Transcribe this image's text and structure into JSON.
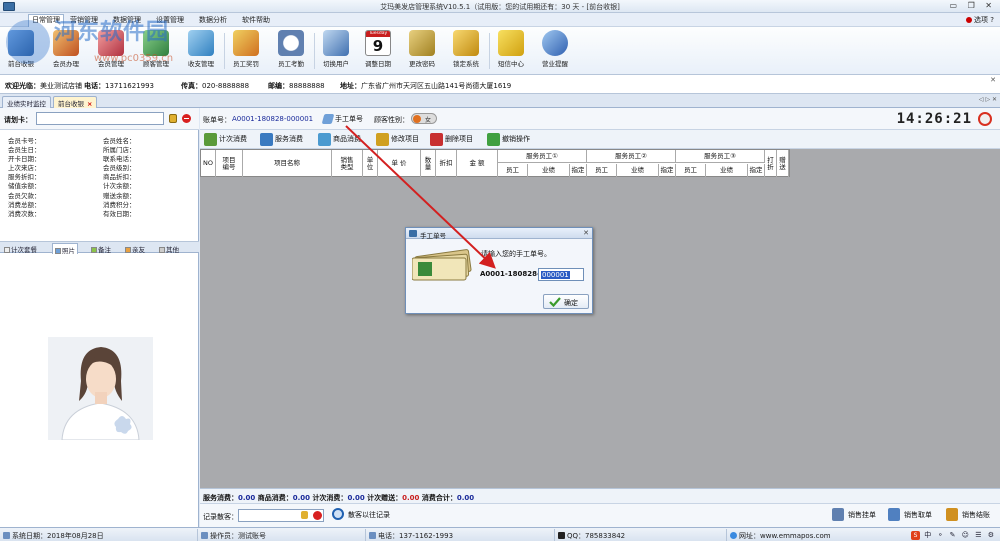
{
  "window": {
    "title": "艾玛美发店管理系统V10.5.1（试用版：您的试用期还有：30 天 - [前台收银]",
    "controls": "▭ ❐ ✕"
  },
  "menu": {
    "items": [
      "日常管理",
      "营销管理",
      "数据管理",
      "设置管理",
      "数据分析",
      "软件帮助"
    ],
    "options_label": "选项",
    "help_label": "?"
  },
  "ribbon": {
    "buttons": [
      {
        "label": "前台收银",
        "icon": "cash-register-icon"
      },
      {
        "label": "会员办理",
        "icon": "member-icon"
      },
      {
        "label": "会员管理",
        "icon": "member-manage-icon"
      },
      {
        "label": "顾客管理",
        "icon": "customer-icon"
      },
      {
        "label": "收支管理",
        "icon": "finance-icon"
      },
      {
        "label": "员工奖罚",
        "icon": "reward-icon"
      },
      {
        "label": "员工考勤",
        "icon": "attendance-clock-icon"
      },
      {
        "label": "切换用户",
        "icon": "switch-user-icon"
      },
      {
        "label": "调整日期",
        "icon": "calendar-icon"
      },
      {
        "label": "更改密码",
        "icon": "key-icon"
      },
      {
        "label": "锁定系统",
        "icon": "lock-icon"
      },
      {
        "label": "短信中心",
        "icon": "sms-icon"
      },
      {
        "label": "营业提醒",
        "icon": "reminder-icon"
      }
    ],
    "calendar": {
      "month": "Tuesday",
      "day": "9"
    }
  },
  "infobar": {
    "shop_label": "欢迎光临：",
    "shop_value": "美业测试店铺",
    "phone_label": "电话：",
    "phone_value": "13711621993",
    "fax_label": "传真：",
    "fax_value": "020-8888888",
    "post_label": "邮编：",
    "post_value": "88888888",
    "address_label": "地址：",
    "address_value": "广东省广州市天河区五山路141号尚德大厦1619"
  },
  "tabs": [
    {
      "label": "业绩实时监控"
    },
    {
      "label": "前台收银",
      "close": "×"
    }
  ],
  "tabs_nav": "◁ ▷ ✕",
  "left": {
    "card_label": "请划卡：",
    "card_value": "",
    "member_fields": [
      [
        "会员卡号：",
        "会员姓名："
      ],
      [
        "会员生日：",
        "所属门店："
      ],
      [
        "开卡日期：",
        "联系电话："
      ],
      [
        "上次来店：",
        "会员级别："
      ],
      [
        "服务折扣：",
        "商品折扣："
      ],
      [
        "储值余额：",
        "计次余额："
      ],
      [
        "会员欠款：",
        "赠送余额："
      ],
      [
        "消费总额：",
        "消费积分："
      ],
      [
        "消费次数：",
        "有效日期："
      ]
    ],
    "subtabs": [
      "计次套餐",
      "照片",
      "备注",
      "亲友",
      "其他"
    ],
    "active_subtab": "照片"
  },
  "main": {
    "bill_label": "账单号：",
    "bill_no": "A0001-180828-000001",
    "manual_label": "手工单号",
    "gender_label": "顾客性别：",
    "gender_value": "女",
    "clock": "14:26:21",
    "actions": [
      {
        "label": "计次消费",
        "icon": "count-consume-icon",
        "color": "#5a9a3a"
      },
      {
        "label": "服务消费",
        "icon": "service-consume-icon",
        "color": "#3a7ac0"
      },
      {
        "label": "商品消费",
        "icon": "product-consume-icon",
        "color": "#4a9ad0"
      },
      {
        "label": "修改项目",
        "icon": "edit-item-icon",
        "color": "#d0a020"
      },
      {
        "label": "删除项目",
        "icon": "delete-item-icon",
        "color": "#c83030"
      },
      {
        "label": "撤销操作",
        "icon": "undo-icon",
        "color": "#40a040"
      }
    ],
    "grid": {
      "no": "NO",
      "item_code": "项目\n编号",
      "item_name": "项目名称",
      "sale_type": "销售\n类型",
      "unit": "单\n位",
      "price": "单 价",
      "qty": "数\n量",
      "discount": "折扣",
      "amount": "金 额",
      "staff_groups": [
        "服务员工①",
        "服务员工②",
        "服务员工③"
      ],
      "staff_sub": [
        "员工",
        "业绩",
        "指定"
      ],
      "print": "打\n折",
      "gift": "赠\n送"
    },
    "totals": [
      {
        "label": "服务消费：",
        "value": "0.00",
        "red": false
      },
      {
        "label": "商品消费：",
        "value": "0.00",
        "red": false
      },
      {
        "label": "计次消费：",
        "value": "0.00",
        "red": false
      },
      {
        "label": "计次赠送：",
        "value": "0.00",
        "red": true
      },
      {
        "label": "消费合计：",
        "value": "0.00",
        "red": false
      }
    ],
    "record_label": "记录散客：",
    "record_value": "",
    "record_search": "散客以往记录",
    "sale_buttons": [
      {
        "label": "销售挂单",
        "icon": "hang-order-icon",
        "color": "#6080b0"
      },
      {
        "label": "销售取单",
        "icon": "take-order-icon",
        "color": "#5080c0"
      },
      {
        "label": "销售结账",
        "icon": "checkout-icon",
        "color": "#d09020"
      }
    ]
  },
  "dialog": {
    "title": "手工单号",
    "close": "✕",
    "prompt": "请输入您的手工单号。",
    "prefix": "A0001-180828-",
    "input_value": "000001",
    "ok_label": "确定"
  },
  "status": {
    "system_date": "系统日期：2018年08月28日",
    "operator": "操作员：测试账号",
    "phone": "电话：137-1162-1993",
    "qq": "QQ：785833842",
    "website": "网址：www.emmapos.com",
    "tray": "中 ⚬ ✎ ☺ ☰ ⚙"
  },
  "watermark": {
    "text": "河东软件园",
    "url": "www.pc0359.cn"
  },
  "colors": {
    "accent": "#2a5bc4",
    "bill_no": "#1a2a9a",
    "alert_red": "#c81e1e",
    "grid_bg": "#a9aaad"
  }
}
